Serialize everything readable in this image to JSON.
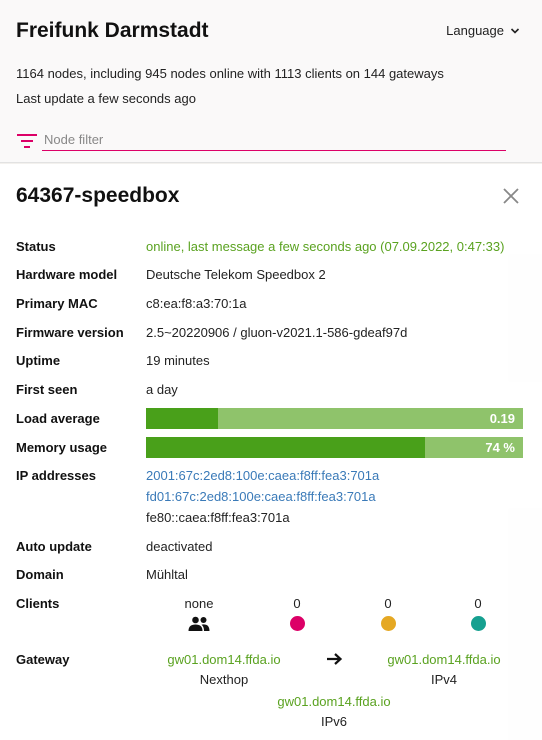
{
  "header": {
    "title": "Freifunk Darmstadt",
    "language_label": "Language",
    "stats": "1164 nodes, including 945 nodes online with 1113 clients on 144 gateways",
    "last_update": "Last update a few seconds ago",
    "filter_placeholder": "Node filter"
  },
  "node": {
    "title": "64367-speedbox",
    "rows": {
      "status": {
        "label": "Status",
        "value": "online, last message a few seconds ago (07.09.2022, 0:47:33)"
      },
      "hardware": {
        "label": "Hardware model",
        "value": "Deutsche Telekom Speedbox 2"
      },
      "mac": {
        "label": "Primary MAC",
        "value": "c8:ea:f8:a3:70:1a"
      },
      "firmware": {
        "label": "Firmware version",
        "value": "2.5~20220906 / gluon-v2021.1-586-gdeaf97d"
      },
      "uptime": {
        "label": "Uptime",
        "value": "19 minutes"
      },
      "first_seen": {
        "label": "First seen",
        "value": "a day"
      },
      "load": {
        "label": "Load average",
        "value": 0.19,
        "text": "0.19",
        "fraction": 0.19
      },
      "memory": {
        "label": "Memory usage",
        "value": 74,
        "text": "74 %",
        "fraction": 0.74
      },
      "ip": {
        "label": "IP addresses",
        "values": [
          "2001:67c:2ed8:100e:caea:f8ff:fea3:701a",
          "fd01:67c:2ed8:100e:caea:f8ff:fea3:701a",
          "fe80::caea:f8ff:fea3:701a"
        ]
      },
      "autoupdate": {
        "label": "Auto update",
        "value": "deactivated"
      },
      "domain": {
        "label": "Domain",
        "value": "Mühltal"
      },
      "clients": {
        "label": "Clients",
        "total": "none",
        "counts": [
          "0",
          "0",
          "0"
        ],
        "dot_colors": [
          "#dc0067",
          "#e5a823",
          "#16a090"
        ]
      },
      "gateway": {
        "label": "Gateway",
        "nexthop": {
          "name": "gw01.dom14.ffda.io",
          "type": "Nexthop"
        },
        "ipv4": {
          "name": "gw01.dom14.ffda.io",
          "type": "IPv4"
        },
        "ipv6": {
          "name": "gw01.dom14.ffda.io",
          "type": "IPv6"
        }
      }
    }
  },
  "colors": {
    "accent": "#dc0067",
    "online": "#5aa220",
    "link": "#3a7ab8",
    "bar_fill": "#49a01a",
    "bar_bg": "#8fc36b"
  },
  "icons": {
    "language": "chevron-down-icon",
    "filter": "filter-icon",
    "close": "close-icon",
    "clients": "people-icon",
    "gateway_arrow": "arrow-right-icon"
  }
}
